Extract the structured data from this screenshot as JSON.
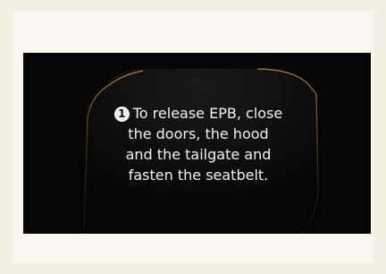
{
  "message": {
    "step_number": "1",
    "lines": [
      "To release EPB, close",
      "the doors, the hood",
      "and the tailgate and",
      "fasten the seatbelt."
    ]
  },
  "colors": {
    "page_background": "#f3ede2",
    "screen_background": "#050505",
    "accent_outline": "#c98a2e",
    "text": "#f2f2f2"
  }
}
